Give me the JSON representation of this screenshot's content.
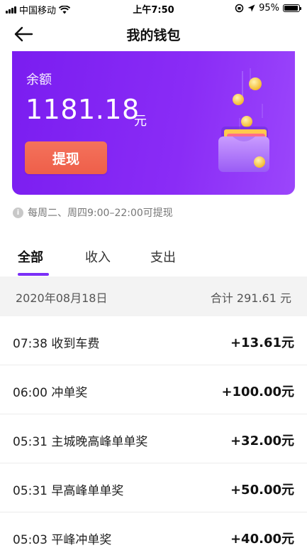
{
  "status_bar": {
    "carrier": "中国移动",
    "time": "上午7:50",
    "battery": "95%"
  },
  "nav": {
    "title": "我的钱包"
  },
  "balance": {
    "label": "余额",
    "amount": "1181.18",
    "unit": "元",
    "withdraw_label": "提现"
  },
  "notice": {
    "text": "每周二、周四9:00–22:00可提现"
  },
  "tabs": [
    {
      "label": "全部",
      "active": true
    },
    {
      "label": "收入",
      "active": false
    },
    {
      "label": "支出",
      "active": false
    }
  ],
  "date_group": {
    "date": "2020年08月18日",
    "total": "合计 291.61 元"
  },
  "transactions": [
    {
      "title": "07:38 收到车费",
      "amount": "+13.61元"
    },
    {
      "title": "06:00 冲单奖",
      "amount": "+100.00元"
    },
    {
      "title": "05:31 主城晚高峰单单奖",
      "amount": "+32.00元"
    },
    {
      "title": "05:31 早高峰单单奖",
      "amount": "+50.00元"
    },
    {
      "title": "05:03 平峰冲单奖",
      "amount": "+40.00元"
    }
  ],
  "colors": {
    "accent": "#7b2ff7",
    "card_gradient_start": "#7a1df0",
    "withdraw_button": "#f06a53"
  }
}
